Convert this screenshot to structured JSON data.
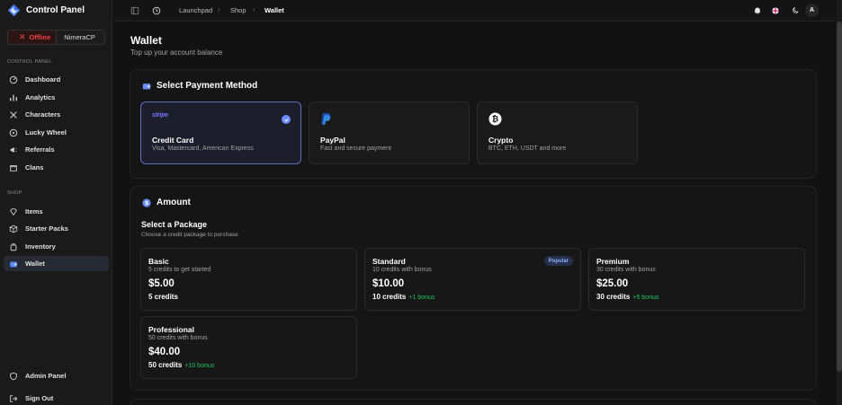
{
  "brand": {
    "title": "Control Panel"
  },
  "server": {
    "status": "Offline",
    "name": "NimeraCP",
    "status_color": "#ef4444"
  },
  "sidebar": {
    "sections": [
      {
        "label": "CONTROL PANEL"
      },
      {
        "label": "SHOP"
      }
    ],
    "items": [
      {
        "label": "Dashboard",
        "icon": "gauge-icon"
      },
      {
        "label": "Analytics",
        "icon": "chart-icon"
      },
      {
        "label": "Characters",
        "icon": "swords-icon"
      },
      {
        "label": "Lucky Wheel",
        "icon": "wheel-icon"
      },
      {
        "label": "Referrals",
        "icon": "megaphone-icon"
      },
      {
        "label": "Clans",
        "icon": "castle-icon"
      },
      {
        "label": "Items",
        "icon": "gem-icon"
      },
      {
        "label": "Starter Packs",
        "icon": "package-icon"
      },
      {
        "label": "Inventory",
        "icon": "backpack-icon"
      },
      {
        "label": "Wallet",
        "icon": "wallet-icon",
        "active": true
      }
    ],
    "footer": [
      {
        "label": "Admin Panel",
        "icon": "shield-icon"
      },
      {
        "label": "Sign Out",
        "icon": "sign-out-icon"
      }
    ]
  },
  "topbar": {
    "breadcrumbs": [
      "Launchpad",
      "Shop",
      "Wallet"
    ],
    "avatar_initial": "A"
  },
  "page": {
    "title": "Wallet",
    "subtitle": "Top up your account balance"
  },
  "payment": {
    "title": "Select Payment Method",
    "methods": [
      {
        "logo_text": "stripe",
        "title": "Credit Card",
        "desc": "Visa, Mastercard, American Express",
        "selected": true
      },
      {
        "title": "PayPal",
        "desc": "Fast and secure payment"
      },
      {
        "title": "Crypto",
        "desc": "BTC, ETH, USDT and more"
      }
    ]
  },
  "amount": {
    "title": "Amount",
    "subtitle": "Select a Package",
    "description": "Choose a credit package to purchase",
    "packages": [
      {
        "name": "Basic",
        "desc": "5 credits to get started",
        "price": "$5.00",
        "credits": "5 credits",
        "bonus": ""
      },
      {
        "name": "Standard",
        "desc": "10 credits with bonus",
        "price": "$10.00",
        "credits": "10 credits",
        "bonus": "+1 bonus",
        "badge": "Popular"
      },
      {
        "name": "Premium",
        "desc": "30 credits with bonus",
        "price": "$25.00",
        "credits": "30 credits",
        "bonus": "+5 bonus"
      },
      {
        "name": "Professional",
        "desc": "50 credits with bonus",
        "price": "$40.00",
        "credits": "50 credits",
        "bonus": "+10 bonus"
      }
    ]
  },
  "colors": {
    "accent": "#6b8cff",
    "bonus": "#22c55e",
    "background": "#121212"
  }
}
